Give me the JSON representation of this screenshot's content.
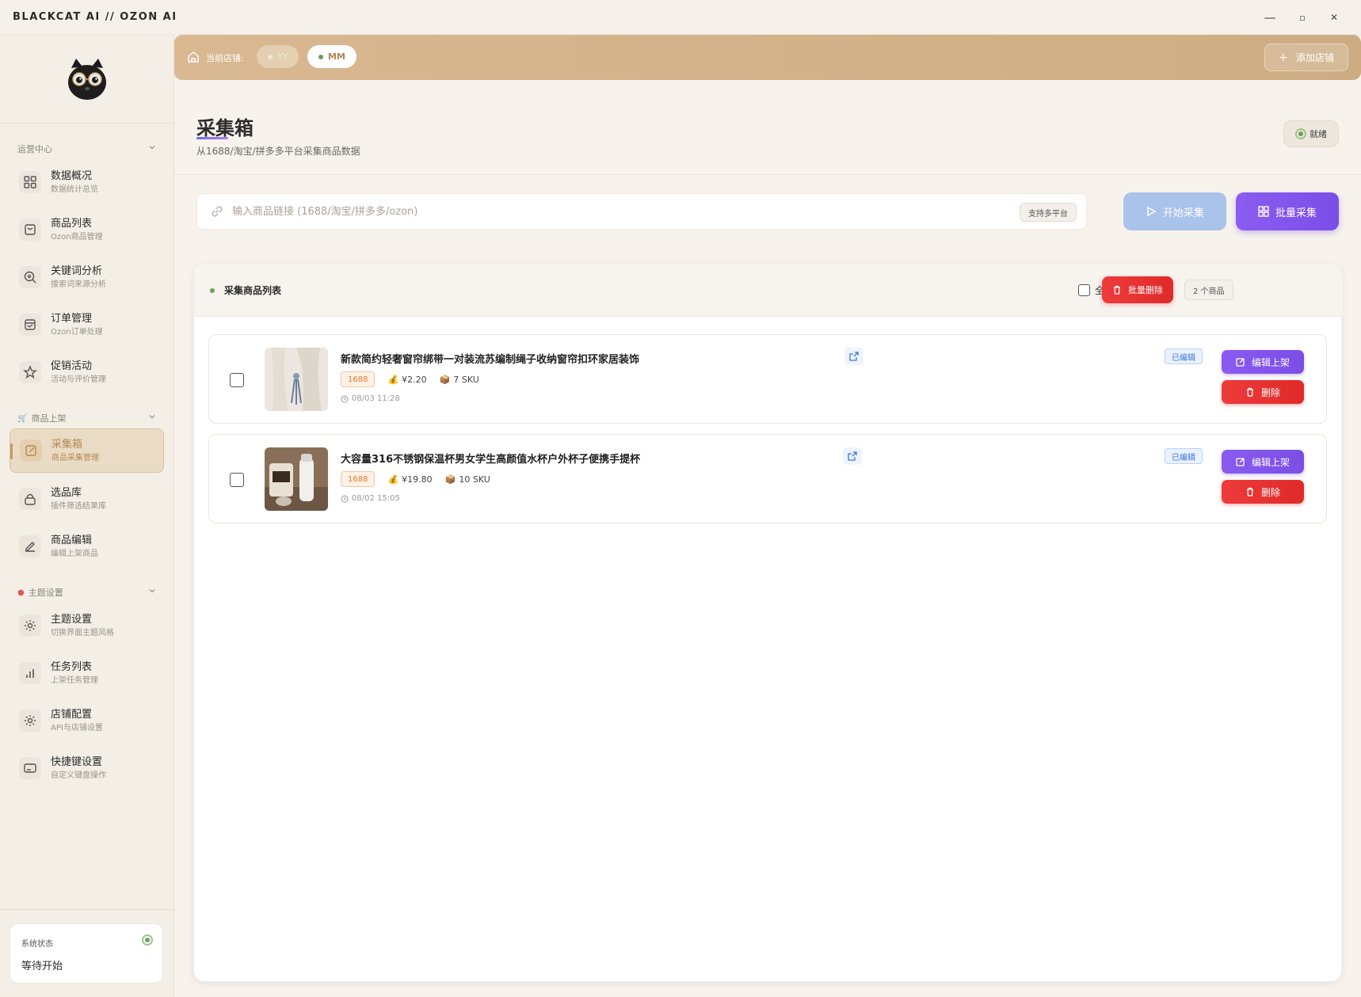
{
  "window": {
    "title": "BLACKCAT AI // OZON AI",
    "minimize": "—",
    "maximize": "▫",
    "close": "✕"
  },
  "sidebar": {
    "sections": [
      {
        "title": "运营中心",
        "items": [
          {
            "label": "数据概况",
            "sub": "数据统计总览",
            "icon": "grid-icon"
          },
          {
            "label": "商品列表",
            "sub": "Ozon商品管理",
            "icon": "bag-icon"
          },
          {
            "label": "关键词分析",
            "sub": "搜索词来源分析",
            "icon": "search-icon"
          },
          {
            "label": "订单管理",
            "sub": "Ozon订单处理",
            "icon": "order-icon"
          },
          {
            "label": "促销活动",
            "sub": "活动与评价管理",
            "icon": "star-icon"
          }
        ]
      },
      {
        "title": "商品上架",
        "items": [
          {
            "label": "采集箱",
            "sub": "商品采集管理",
            "icon": "collect-icon"
          },
          {
            "label": "选品库",
            "sub": "插件筛选结果库",
            "icon": "lock-icon"
          },
          {
            "label": "商品编辑",
            "sub": "编辑上架商品",
            "icon": "edit-icon"
          }
        ]
      },
      {
        "title": "主题设置",
        "items": [
          {
            "label": "主题设置",
            "sub": "切换界面主题风格",
            "icon": "gear-icon"
          },
          {
            "label": "任务列表",
            "sub": "上架任务管理",
            "icon": "bar-chart-icon"
          },
          {
            "label": "店铺配置",
            "sub": "API与店铺设置",
            "icon": "gear-icon"
          },
          {
            "label": "快捷键设置",
            "sub": "自定义键盘操作",
            "icon": "keyboard-icon"
          }
        ]
      }
    ],
    "active": "采集箱",
    "status": {
      "label": "系统状态",
      "value": "等待开始"
    }
  },
  "store_bar": {
    "label": "当前店铺:",
    "stores": [
      {
        "name": "YY",
        "active": false
      },
      {
        "name": "MM",
        "active": true
      }
    ],
    "add_label": "添加店铺"
  },
  "page": {
    "title": "采集箱",
    "subtitle": "从1688/淘宝/拼多多平台采集商品数据",
    "status": "就绪"
  },
  "collect": {
    "placeholder": "输入商品链接 (1688/淘宝/拼多多/ozon)",
    "platform_tag": "支持多平台",
    "start_label": "开始采集",
    "batch_label": "批量采集"
  },
  "list": {
    "title": "采集商品列表",
    "select_all": "全选",
    "batch_delete": "批量删除",
    "count": "2 个商品",
    "items": [
      {
        "title": "新款简约轻奢窗帘绑带一对装流苏编制绳子收纳窗帘扣环家居装饰",
        "source": "1688",
        "price": "¥2.20",
        "sku": "7 SKU",
        "time": "08/03 11:28",
        "status": "已编辑"
      },
      {
        "title": "大容量316不锈钢保温杯男女学生高颜值水杯户外杯子便携手提杯",
        "source": "1688",
        "price": "¥19.80",
        "sku": "10 SKU",
        "time": "08/02 15:05",
        "status": "已编辑"
      }
    ],
    "edit_label": "编辑上架",
    "delete_label": "删除"
  },
  "colors": {
    "accent": "#7b4ee6",
    "danger": "#e02a2a",
    "store_bar": "#d4b38b",
    "start_btn": "#a9c3ea",
    "ready": "#6aa05a"
  }
}
